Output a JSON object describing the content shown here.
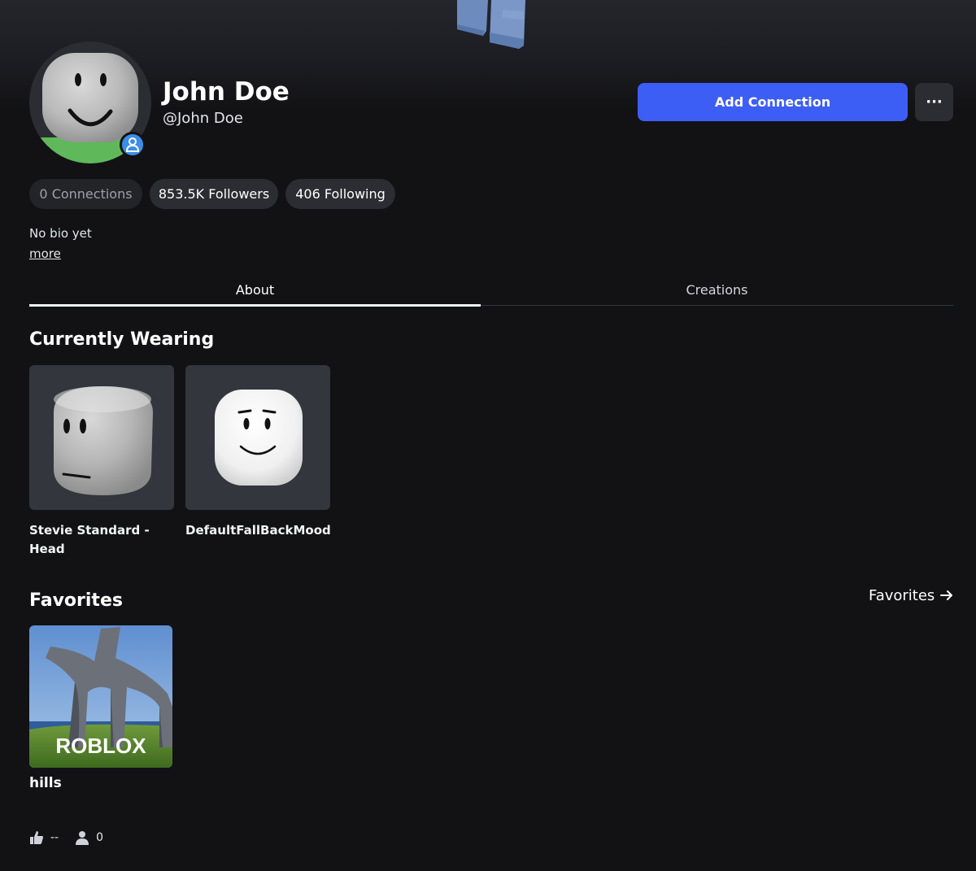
{
  "profile": {
    "display_name": "John Doe",
    "username": "@John Doe",
    "bio": "No bio yet",
    "more_label": "more"
  },
  "actions": {
    "add_connection_label": "Add Connection",
    "more_options_label": "···"
  },
  "stats": {
    "connections": "0 Connections",
    "followers": "853.5K Followers",
    "following": "406 Following"
  },
  "tabs": [
    {
      "label": "About",
      "active": true
    },
    {
      "label": "Creations",
      "active": false
    }
  ],
  "currently_wearing": {
    "title": "Currently Wearing",
    "items": [
      {
        "name": "Stevie Standard - Head"
      },
      {
        "name": "DefaultFallBackMood"
      }
    ]
  },
  "favorites": {
    "title": "Favorites",
    "link_label": "Favorites",
    "games": [
      {
        "name": "hills",
        "thumbnail_logo": "ROBLOX",
        "likes": "--",
        "players": "0"
      }
    ]
  },
  "colors": {
    "accent": "#3d5ef5",
    "background": "#121215",
    "surface": "#2b2d33",
    "presence": "#3a8ee8"
  },
  "icons": {
    "presence": "person-icon",
    "favorites_arrow": "arrow-right-icon",
    "likes": "thumbs-up-icon",
    "players": "person-icon"
  }
}
